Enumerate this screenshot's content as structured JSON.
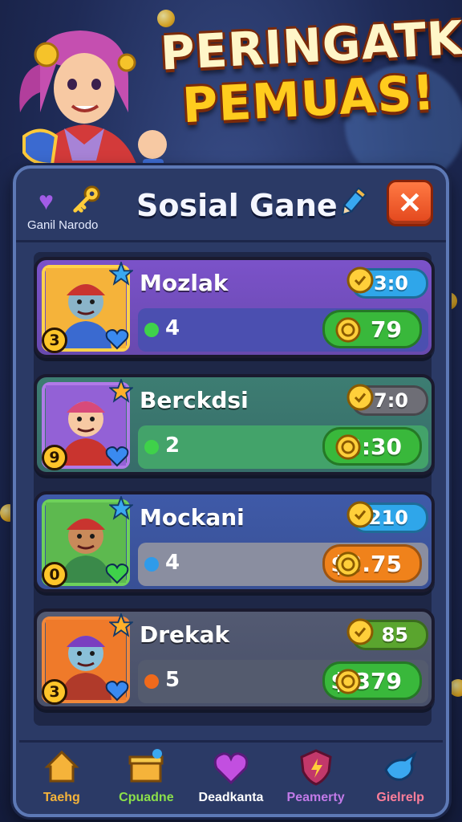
{
  "hero": {
    "title_line1": "PERINGATK",
    "title_line2": "PEMUAS!"
  },
  "panel": {
    "subtitle": "Ganil Narodo",
    "title": "Sosial Gane",
    "close_label": "✕"
  },
  "players": [
    {
      "name": "Mozlak",
      "level": "3",
      "count": "4",
      "top_value": "3:0",
      "bottom_value": "79",
      "row_color": "#7b52c9",
      "bar_color": "#4b4fb0",
      "dot_color": "#3fd14a",
      "top_pill_color": "#2fa6ea",
      "bottom_pill_color": "#39b83b",
      "portrait_bg": "#f5b33a"
    },
    {
      "name": "Berckdsi",
      "level": "9",
      "count": "2",
      "top_value": "7:0",
      "bottom_value": "3:30",
      "row_color": "#3d7d72",
      "bar_color": "#43a36a",
      "dot_color": "#3fd14a",
      "top_pill_color": "#6e6e76",
      "bottom_pill_color": "#39b83b",
      "portrait_bg": "#9361d6"
    },
    {
      "name": "Mockani",
      "level": "0",
      "count": "4",
      "top_value": "210",
      "bottom_value": "$3.75",
      "row_color": "#3f5aa8",
      "bar_color": "#8a8ea0",
      "dot_color": "#2f9bea",
      "top_pill_color": "#2fa6ea",
      "bottom_pill_color": "#f0821b",
      "portrait_bg": "#5db94f"
    },
    {
      "name": "Drekak",
      "level": "3",
      "count": "5",
      "top_value": "85",
      "bottom_value": "$.379",
      "row_color": "#535a72",
      "bar_color": "#545b6e",
      "dot_color": "#f06a1b",
      "top_pill_color": "#5aa52e",
      "bottom_pill_color": "#39b83b",
      "portrait_bg": "#ef7a2a"
    }
  ],
  "nav": [
    {
      "label": "Taehg",
      "icon": "home-icon",
      "color": "#f5b33a"
    },
    {
      "label": "Cpuadne",
      "icon": "gift-icon",
      "color": "#8be04a"
    },
    {
      "label": "Deadkanta",
      "icon": "heart-icon",
      "color": "#ffffff"
    },
    {
      "label": "Peamerty",
      "icon": "lightning-shield-icon",
      "color": "#c27ae8"
    },
    {
      "label": "Gielrelp",
      "icon": "bird-icon",
      "color": "#ff7e9a"
    }
  ]
}
